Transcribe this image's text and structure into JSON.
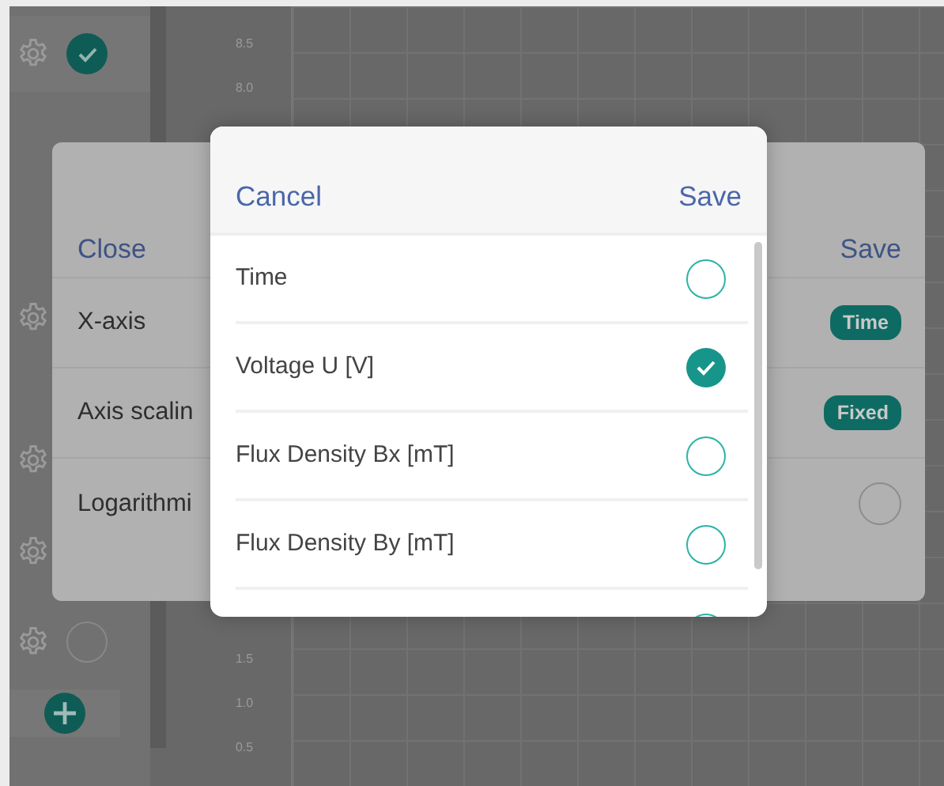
{
  "background": {
    "sidebar": {
      "items": [
        {
          "kind": "toggle",
          "checked": true
        },
        {
          "kind": "plain"
        },
        {
          "kind": "plain"
        },
        {
          "kind": "plain"
        },
        {
          "kind": "toggle",
          "checked": false
        }
      ]
    },
    "axis": {
      "upper_ticks": [
        "8.5",
        "8.0"
      ],
      "lower_ticks": [
        "1.5",
        "1.0",
        "0.5"
      ]
    }
  },
  "settings_dialog": {
    "close": "Close",
    "save": "Save",
    "rows": [
      {
        "label": "X-axis",
        "kind": "badge",
        "value": "Time"
      },
      {
        "label": "Axis scalin",
        "kind": "badge",
        "value": "Fixed"
      },
      {
        "label": "Logarithmi",
        "kind": "toggle",
        "on": false
      }
    ]
  },
  "picker_dialog": {
    "cancel": "Cancel",
    "save": "Save",
    "options": [
      {
        "label": "Time",
        "selected": false
      },
      {
        "label": "Voltage U [V]",
        "selected": true
      },
      {
        "label": "Flux Density Bx [mT]",
        "selected": false
      },
      {
        "label": "Flux Density By [mT]",
        "selected": false
      },
      {
        "selected": false
      }
    ]
  }
}
